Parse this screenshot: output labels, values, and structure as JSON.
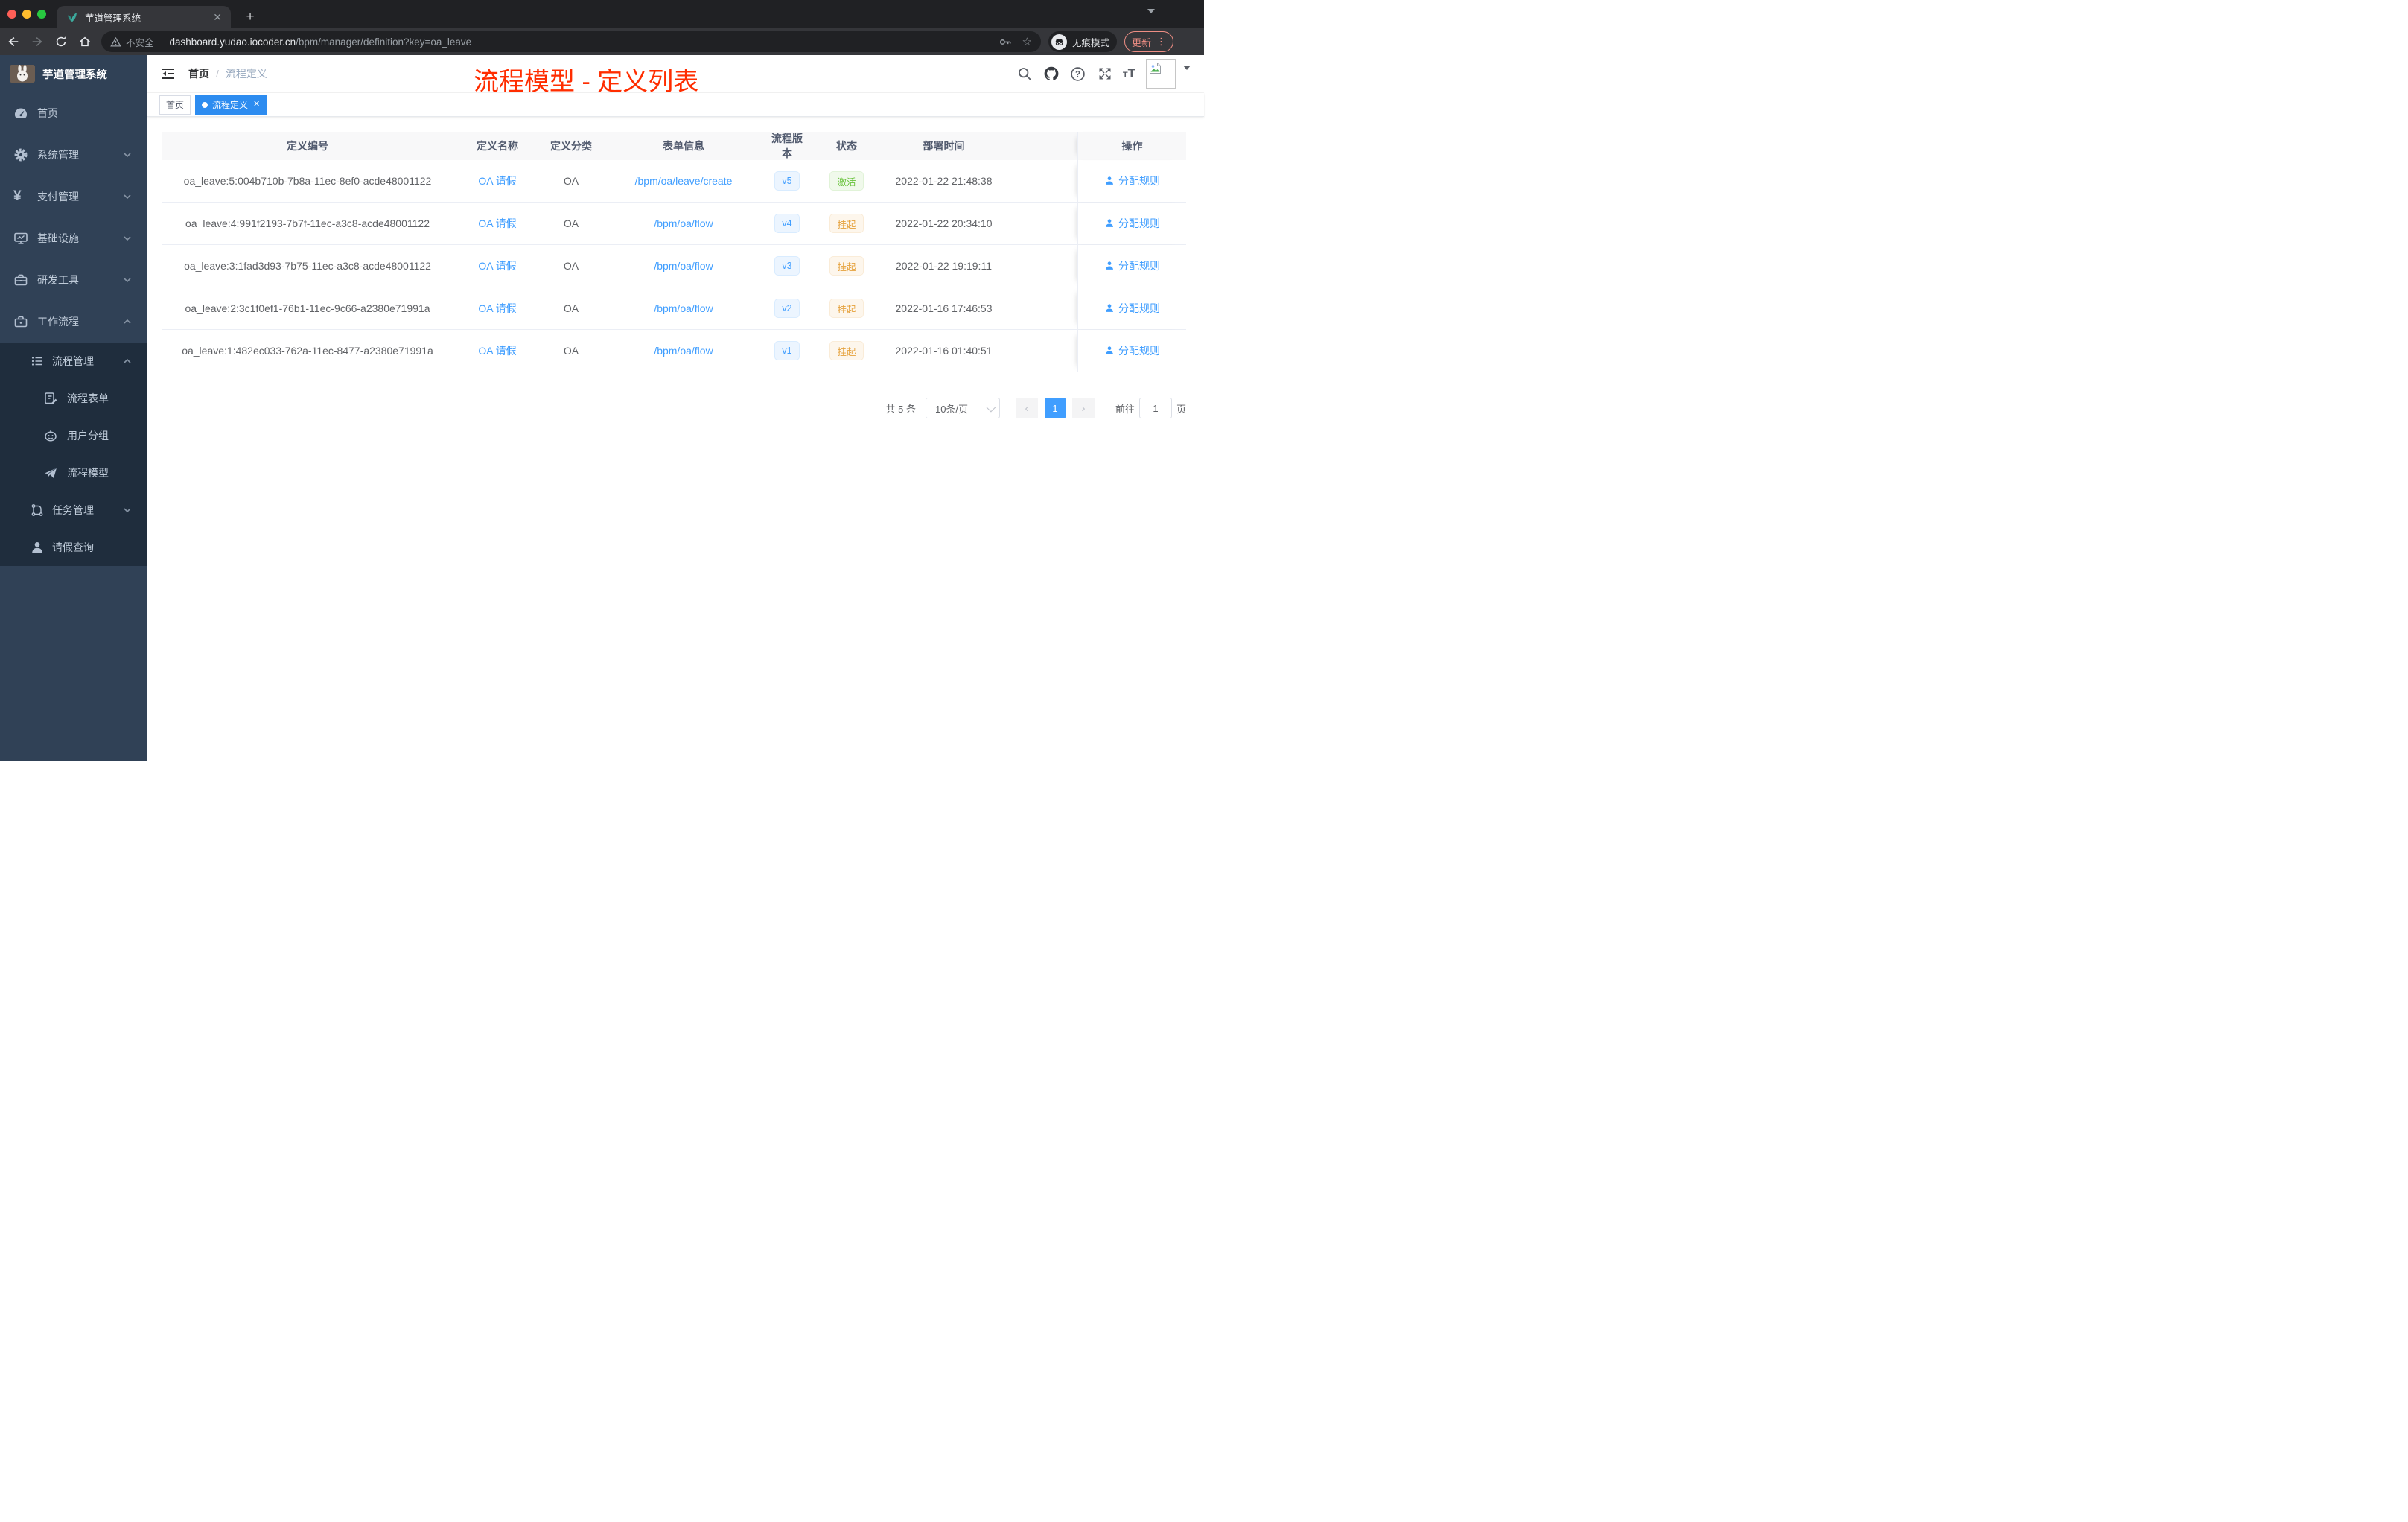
{
  "browser": {
    "tab_title": "芋道管理系统",
    "not_secure": "不安全",
    "url_host": "dashboard.yudao.iocoder.cn",
    "url_path": "/bpm/manager/definition?key=oa_leave",
    "incognito_label": "无痕模式",
    "update_label": "更新"
  },
  "sidebar": {
    "logo_title": "芋道管理系统",
    "items": [
      {
        "label": "首页",
        "icon": "dashboard-icon",
        "arrow": "none"
      },
      {
        "label": "系统管理",
        "icon": "gear-icon",
        "arrow": "down"
      },
      {
        "label": "支付管理",
        "icon": "yen-icon",
        "arrow": "down"
      },
      {
        "label": "基础设施",
        "icon": "monitor-icon",
        "arrow": "down"
      },
      {
        "label": "研发工具",
        "icon": "toolbox-icon",
        "arrow": "down"
      },
      {
        "label": "工作流程",
        "icon": "briefcase-icon",
        "arrow": "up"
      }
    ],
    "submenu": [
      {
        "label": "流程管理",
        "icon": "list-icon",
        "arrow": "up"
      },
      {
        "label": "流程表单",
        "icon": "form-icon",
        "arrow": "none"
      },
      {
        "label": "用户分组",
        "icon": "robot-icon",
        "arrow": "none"
      },
      {
        "label": "流程模型",
        "icon": "paper-plane-icon",
        "arrow": "none"
      },
      {
        "label": "任务管理",
        "icon": "flow-icon",
        "arrow": "down"
      },
      {
        "label": "请假查询",
        "icon": "user-icon",
        "arrow": "none"
      }
    ]
  },
  "header": {
    "breadcrumb": [
      "首页",
      "流程定义"
    ],
    "breadcrumb_sep": "/",
    "annotation": "流程模型 - 定义列表"
  },
  "tags": [
    {
      "label": "首页",
      "active": false
    },
    {
      "label": "流程定义",
      "active": true
    }
  ],
  "table": {
    "columns": [
      "定义编号",
      "定义名称",
      "定义分类",
      "表单信息",
      "流程版本",
      "状态",
      "部署时间",
      "操作"
    ],
    "rows": [
      {
        "id": "oa_leave:5:004b710b-7b8a-11ec-8ef0-acde48001122",
        "name": "OA 请假",
        "category": "OA",
        "form": "/bpm/oa/leave/create",
        "version": "v5",
        "status": "激活",
        "time": "2022-01-22 21:48:38",
        "action": "分配规则"
      },
      {
        "id": "oa_leave:4:991f2193-7b7f-11ec-a3c8-acde48001122",
        "name": "OA 请假",
        "category": "OA",
        "form": "/bpm/oa/flow",
        "version": "v4",
        "status": "挂起",
        "time": "2022-01-22 20:34:10",
        "action": "分配规则"
      },
      {
        "id": "oa_leave:3:1fad3d93-7b75-11ec-a3c8-acde48001122",
        "name": "OA 请假",
        "category": "OA",
        "form": "/bpm/oa/flow",
        "version": "v3",
        "status": "挂起",
        "time": "2022-01-22 19:19:11",
        "action": "分配规则"
      },
      {
        "id": "oa_leave:2:3c1f0ef1-76b1-11ec-9c66-a2380e71991a",
        "name": "OA 请假",
        "category": "OA",
        "form": "/bpm/oa/flow",
        "version": "v2",
        "status": "挂起",
        "time": "2022-01-16 17:46:53",
        "action": "分配规则"
      },
      {
        "id": "oa_leave:1:482ec033-762a-11ec-8477-a2380e71991a",
        "name": "OA 请假",
        "category": "OA",
        "form": "/bpm/oa/flow",
        "version": "v1",
        "status": "挂起",
        "time": "2022-01-16 01:40:51",
        "action": "分配规则"
      }
    ]
  },
  "pagination": {
    "total": "共 5 条",
    "page_size": "10条/页",
    "current": "1",
    "goto_label": "前往",
    "goto_value": "1",
    "page_label": "页"
  },
  "colors": {
    "accent_blue": "#409eff",
    "tag_active_blue": "#2d8cf0",
    "annotation_red": "#ff2d00",
    "status_active_green": "#67c23a",
    "status_suspend_yellow": "#e6a23c",
    "sidebar_bg": "#304156",
    "submenu_bg": "#1f2d3d",
    "update_button": "#ee8e84"
  }
}
